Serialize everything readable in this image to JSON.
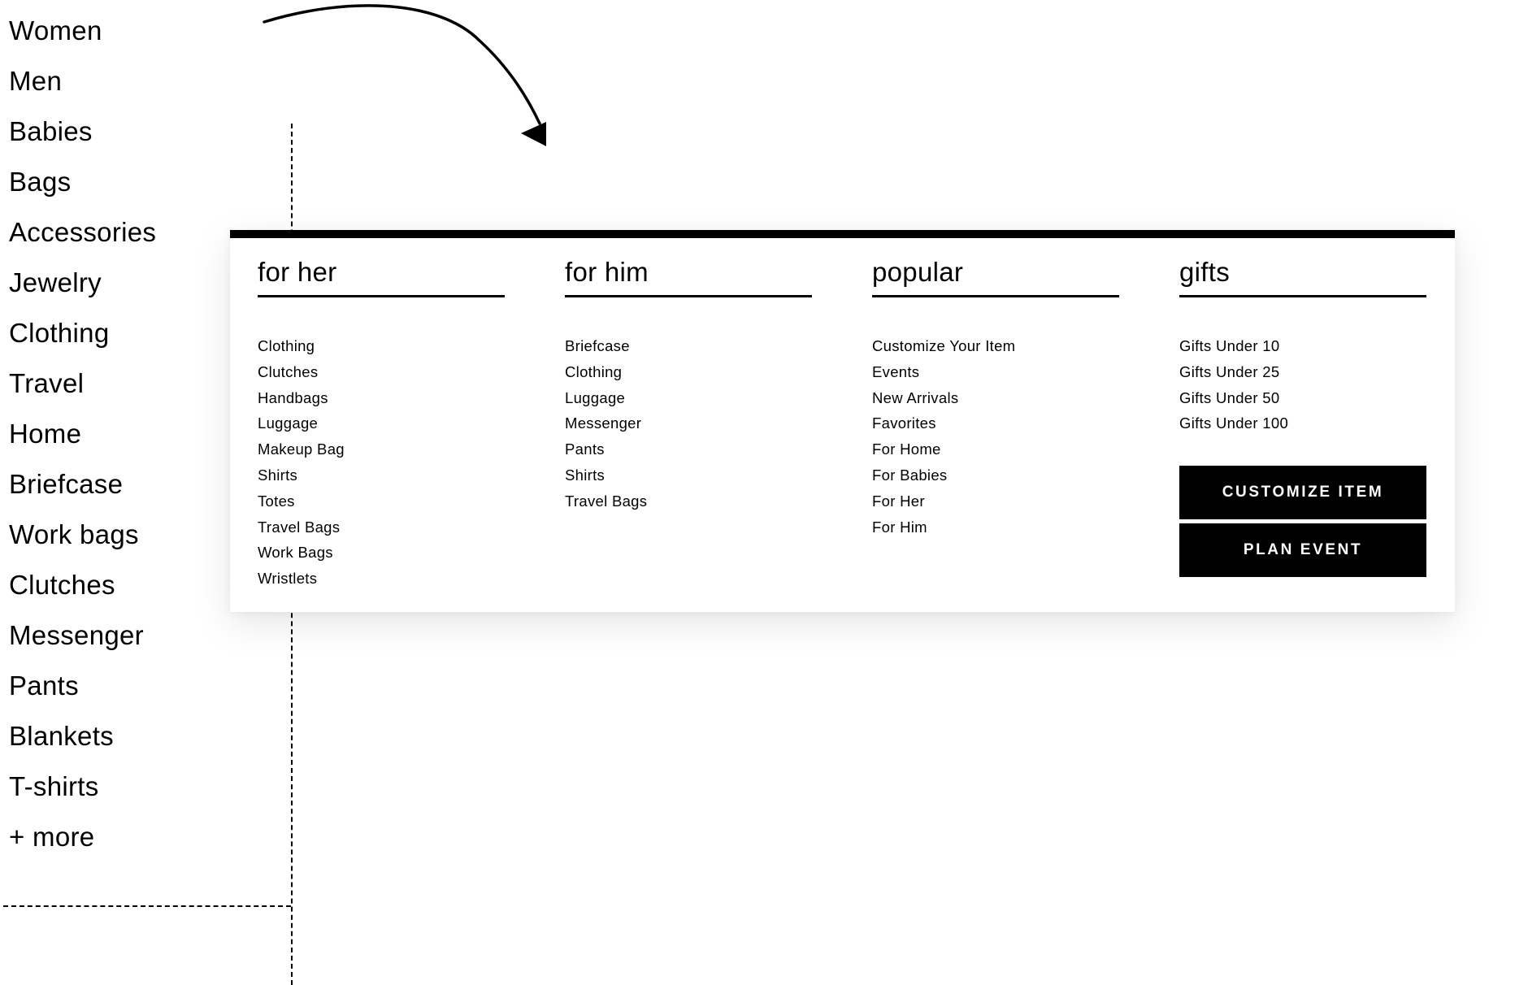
{
  "categories": [
    "Women",
    "Men",
    "Babies",
    "Bags",
    "Accessories",
    "Jewelry",
    "Clothing",
    "Travel",
    "Home",
    "Briefcase",
    "Work bags",
    "Clutches",
    "Messenger",
    "Pants",
    "Blankets",
    "T-shirts",
    "+ more"
  ],
  "menu": {
    "columns": [
      {
        "title": "for her",
        "links": [
          "Clothing",
          "Clutches",
          "Handbags",
          "Luggage",
          "Makeup Bag",
          "Shirts",
          "Totes",
          "Travel Bags",
          "Work Bags",
          "Wristlets"
        ]
      },
      {
        "title": "for him",
        "links": [
          "Briefcase",
          "Clothing",
          "Luggage",
          "Messenger",
          "Pants",
          "Shirts",
          "Travel Bags"
        ]
      },
      {
        "title": "popular",
        "links": [
          "Customize Your Item",
          "Events",
          "New Arrivals",
          "Favorites",
          "For Home",
          "For Babies",
          "For Her",
          "For Him"
        ]
      },
      {
        "title": "gifts",
        "links": [
          "Gifts Under 10",
          "Gifts Under 25",
          "Gifts Under 50",
          "Gifts Under 100"
        ]
      }
    ],
    "buttons": {
      "customize": "CUSTOMIZE ITEM",
      "plan": "PLAN EVENT"
    }
  },
  "icons": {
    "arrow": "curved-arrow-icon"
  },
  "colors": {
    "ink": "#000000",
    "background": "#ffffff"
  }
}
